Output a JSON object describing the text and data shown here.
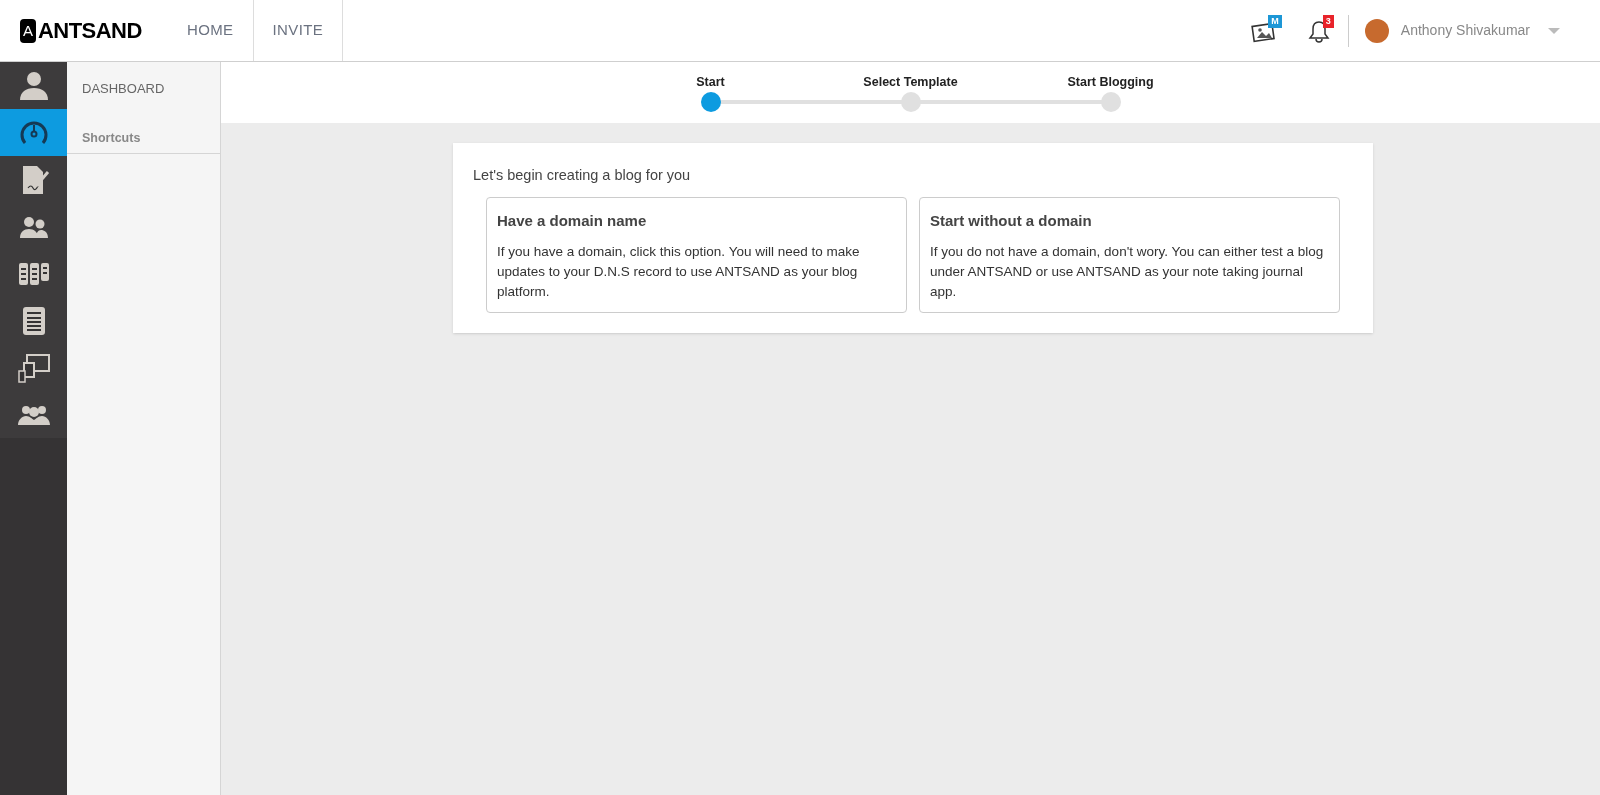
{
  "header": {
    "logo": "ANTSAND",
    "logo_mark": "A",
    "nav": [
      {
        "label": "HOME"
      },
      {
        "label": "INVITE"
      }
    ],
    "media_badge": "M",
    "notification_count": "3",
    "user_name": "Anthony Shivakumar"
  },
  "icon_bar": [
    {
      "selected": false
    },
    {
      "selected": true
    },
    {
      "selected": false
    },
    {
      "selected": false
    },
    {
      "selected": false
    },
    {
      "selected": false
    },
    {
      "selected": false
    },
    {
      "selected": false
    }
  ],
  "side_menu": {
    "title": "DASHBOARD",
    "section": "Shortcuts"
  },
  "steps": [
    {
      "label": "Start",
      "selected": true
    },
    {
      "label": "Select Template",
      "selected": false
    },
    {
      "label": "Start Blogging",
      "selected": false
    }
  ],
  "card": {
    "heading": "Let's begin creating a blog for you",
    "options": [
      {
        "title": "Have a domain name",
        "text": "If you have a domain, click this option. You will need to make updates to your D.N.S record to use ANTSAND as your blog platform."
      },
      {
        "title": "Start without a domain",
        "text": "If you do not have a domain, don't wory. You can either test a blog under ANTSAND or use ANTSAND as your note taking journal app."
      }
    ]
  }
}
